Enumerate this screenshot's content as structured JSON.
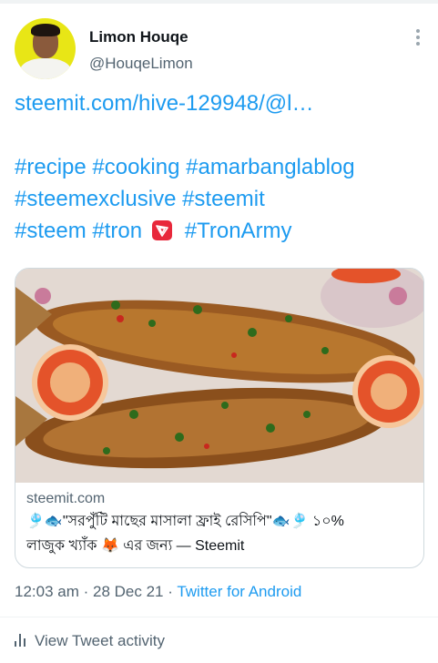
{
  "author": {
    "name": "Limon Houqe",
    "handle": "@HouqeLimon"
  },
  "tweet": {
    "link": "steemit.com/hive-129948/@l…",
    "hashtags_line1": "#recipe #cooking #amarbanglablog",
    "hashtags_line2": "#steemexclusive #steemit",
    "hashtags_line3_a": "#steem #tron",
    "hashtags_line3_b": "#TronArmy"
  },
  "card": {
    "domain": "steemit.com",
    "title_line1": "🎐🐟\"সরপুঁটি মাছের মাসালা ফ্রাই রেসিপি\"🐟🎐 ১০%",
    "title_line2": "লাজুক খ্যাঁক 🦊 এর জন্য — Steemit"
  },
  "meta": {
    "time": "12:03 am",
    "sep1": " · ",
    "date": "28 Dec 21",
    "sep2": " · ",
    "source": "Twitter for Android"
  },
  "activity": {
    "label": "View Tweet activity"
  },
  "colors": {
    "link": "#1d9bf0",
    "secondary": "#536471",
    "tron": "#e8283b"
  }
}
